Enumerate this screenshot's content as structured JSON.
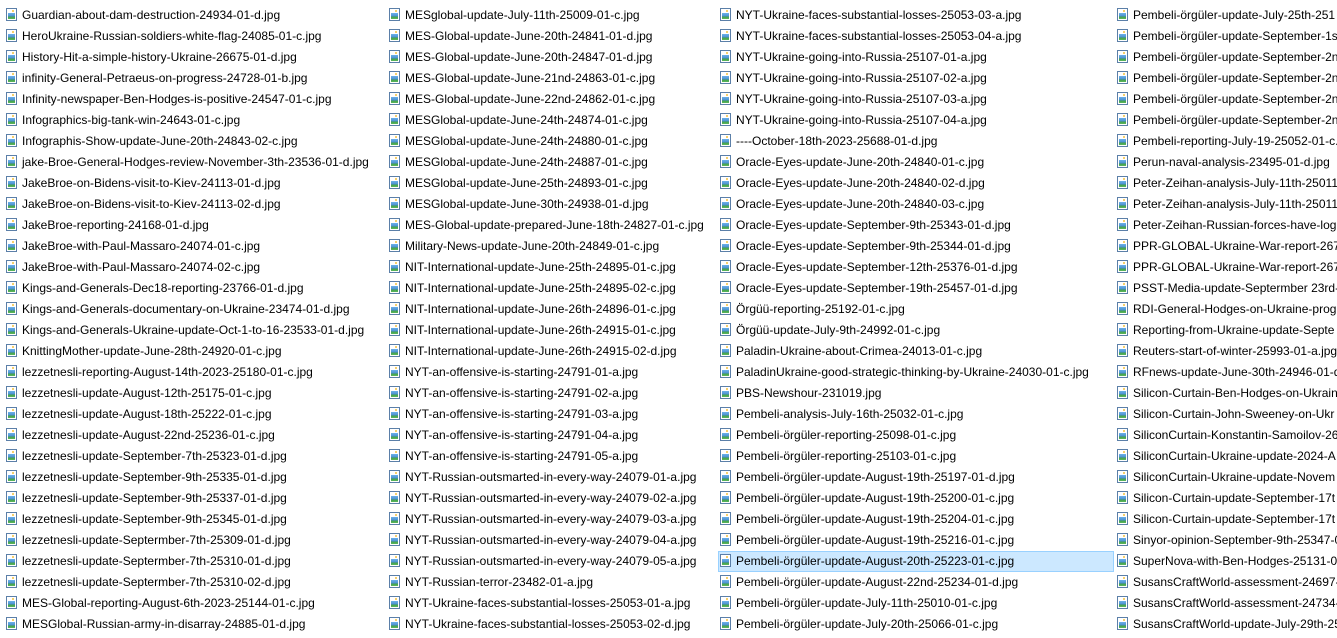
{
  "colors": {
    "selection_background": "#cce8ff",
    "selection_border": "#99d1ff",
    "text": "#000000"
  },
  "icon": "image-file-icon",
  "selected_file": "Pembeli-örgüler-update-August-20th-25223-01-c.jpg",
  "columns": [
    {
      "files": [
        "Guardian-about-dam-destruction-24934-01-d.jpg",
        "HeroUkraine-Russian-soldiers-white-flag-24085-01-c.jpg",
        "History-Hit-a-simple-history-Ukraine-26675-01-d.jpg",
        "infinity-General-Petraeus-on-progress-24728-01-b.jpg",
        "Infinity-newspaper-Ben-Hodges-is-positive-24547-01-c.jpg",
        "Infographics-big-tank-win-24643-01-c.jpg",
        "Infographis-Show-update-June-20th-24843-02-c.jpg",
        "jake-Broe-General-Hodges-review-November-3th-23536-01-d.jpg",
        "JakeBroe-on-Bidens-visit-to-Kiev-24113-01-d.jpg",
        "JakeBroe-on-Bidens-visit-to-Kiev-24113-02-d.jpg",
        "JakeBroe-reporting-24168-01-d.jpg",
        "JakeBroe-with-Paul-Massaro-24074-01-c.jpg",
        "JakeBroe-with-Paul-Massaro-24074-02-c.jpg",
        "Kings-and-Generals-Dec18-reporting-23766-01-d.jpg",
        "Kings-and-Generals-documentary-on-Ukraine-23474-01-d.jpg",
        "Kings-and-Generals-Ukraine-update-Oct-1-to-16-23533-01-d.jpg",
        "KnittingMother-update-June-28th-24920-01-c.jpg",
        "lezzetnesli-reporting-August-14th-2023-25180-01-c.jpg",
        "lezzetnesli-update-August-12th-25175-01-c.jpg",
        "lezzetnesli-update-August-18th-25222-01-c.jpg",
        "lezzetnesli-update-August-22nd-25236-01-c.jpg",
        "lezzetnesli-update-September-7th-25323-01-d.jpg",
        "lezzetnesli-update-September-9th-25335-01-d.jpg",
        "lezzetnesli-update-September-9th-25337-01-d.jpg",
        "lezzetnesli-update-September-9th-25345-01-d.jpg",
        "lezzetnesli-update-Septermber-7th-25309-01-d.jpg",
        "lezzetnesli-update-Septermber-7th-25310-01-d.jpg",
        "lezzetnesli-update-Septermber-7th-25310-02-d.jpg",
        "MES-Global-reporting-August-6th-2023-25144-01-c.jpg",
        "MESGlobal-Russian-army-in-disarray-24885-01-d.jpg"
      ]
    },
    {
      "files": [
        "MESglobal-update-July-11th-25009-01-c.jpg",
        "MES-Global-update-June-20th-24841-01-d.jpg",
        "MES-Global-update-June-20th-24847-01-d.jpg",
        "MES-Global-update-June-21nd-24863-01-c.jpg",
        "MES-Global-update-June-22nd-24862-01-c.jpg",
        "MESGlobal-update-June-24th-24874-01-c.jpg",
        "MESGlobal-update-June-24th-24880-01-c.jpg",
        "MESGlobal-update-June-24th-24887-01-c.jpg",
        "MESGlobal-update-June-25th-24893-01-c.jpg",
        "MESGlobal-update-June-30th-24938-01-d.jpg",
        "MES-Global-update-prepared-June-18th-24827-01-c.jpg",
        "Military-News-update-June-20th-24849-01-c.jpg",
        "NIT-International-update-June-25th-24895-01-c.jpg",
        "NIT-International-update-June-25th-24895-02-c.jpg",
        "NIT-International-update-June-26th-24896-01-c.jpg",
        "NIT-International-update-June-26th-24915-01-c.jpg",
        "NIT-International-update-June-26th-24915-02-d.jpg",
        "NYT-an-offensive-is-starting-24791-01-a.jpg",
        "NYT-an-offensive-is-starting-24791-02-a.jpg",
        "NYT-an-offensive-is-starting-24791-03-a.jpg",
        "NYT-an-offensive-is-starting-24791-04-a.jpg",
        "NYT-an-offensive-is-starting-24791-05-a.jpg",
        "NYT-Russian-outsmarted-in-every-way-24079-01-a.jpg",
        "NYT-Russian-outsmarted-in-every-way-24079-02-a.jpg",
        "NYT-Russian-outsmarted-in-every-way-24079-03-a.jpg",
        "NYT-Russian-outsmarted-in-every-way-24079-04-a.jpg",
        "NYT-Russian-outsmarted-in-every-way-24079-05-a.jpg",
        "NYT-Russian-terror-23482-01-a.jpg",
        "NYT-Ukraine-faces-substantial-losses-25053-01-a.jpg",
        "NYT-Ukraine-faces-substantial-losses-25053-02-d.jpg"
      ]
    },
    {
      "files": [
        "NYT-Ukraine-faces-substantial-losses-25053-03-a.jpg",
        "NYT-Ukraine-faces-substantial-losses-25053-04-a.jpg",
        "NYT-Ukraine-going-into-Russia-25107-01-a.jpg",
        "NYT-Ukraine-going-into-Russia-25107-02-a.jpg",
        "NYT-Ukraine-going-into-Russia-25107-03-a.jpg",
        "NYT-Ukraine-going-into-Russia-25107-04-a.jpg",
        "----October-18th-2023-25688-01-d.jpg",
        "Oracle-Eyes-update-June-20th-24840-01-c.jpg",
        "Oracle-Eyes-update-June-20th-24840-02-d.jpg",
        "Oracle-Eyes-update-June-20th-24840-03-c.jpg",
        "Oracle-Eyes-update-September-9th-25343-01-d.jpg",
        "Oracle-Eyes-update-September-9th-25344-01-d.jpg",
        "Oracle-Eyes-update-September-12th-25376-01-d.jpg",
        "Oracle-Eyes-update-September-19th-25457-01-d.jpg",
        "Örgüü-reporting-25192-01-c.jpg",
        "Örgüü-update-July-9th-24992-01-c.jpg",
        "Paladin-Ukraine-about-Crimea-24013-01-c.jpg",
        "PaladinUkraine-good-strategic-thinking-by-Ukraine-24030-01-c.jpg",
        "PBS-Newshour-231019.jpg",
        "Pembeli-analysis-July-16th-25032-01-c.jpg",
        "Pembeli-örgüler-reporting-25098-01-c.jpg",
        "Pembeli-örgüler-reporting-25103-01-c.jpg",
        "Pembeli-örgüler-update-August-19th-25197-01-d.jpg",
        "Pembeli-örgüler-update-August-19th-25200-01-c.jpg",
        "Pembeli-örgüler-update-August-19th-25204-01-c.jpg",
        "Pembeli-örgüler-update-August-19th-25216-01-c.jpg",
        "Pembeli-örgüler-update-August-20th-25223-01-c.jpg",
        "Pembeli-örgüler-update-August-22nd-25234-01-d.jpg",
        "Pembeli-örgüler-update-July-11th-25010-01-c.jpg",
        "Pembeli-örgüler-update-July-20th-25066-01-c.jpg"
      ]
    },
    {
      "files": [
        "Pembeli-örgüler-update-July-25th-251",
        "Pembeli-örgüler-update-September-1s",
        "Pembeli-örgüler-update-September-2n",
        "Pembeli-örgüler-update-September-2n",
        "Pembeli-örgüler-update-September-2n",
        "Pembeli-örgüler-update-September-2n",
        "Pembeli-reporting-July-19-25052-01-c.",
        "Perun-naval-analysis-23495-01-d.jpg",
        "Peter-Zeihan-analysis-July-11th-25011-",
        "Peter-Zeihan-analysis-July-11th-25011-",
        "Peter-Zeihan-Russian-forces-have-logi",
        "PPR-GLOBAL-Ukraine-War-report-2677",
        "PPR-GLOBAL-Ukraine-War-report-2677",
        "PSST-Media-update-Septermber 23rd-2",
        "RDI-General-Hodges-on-Ukraine-prog",
        "Reporting-from-Ukraine-update-Septe",
        "Reuters-start-of-winter-25993-01-a.jpg",
        "RFnews-update-June-30th-24946-01-d",
        "Silicon-Curtain-Ben-Hodges-on-Ukrain",
        "Silicon-Curtain-John-Sweeney-on-Ukr",
        "SiliconCurtain-Konstantin-Samoilov-26",
        "SiliconCurtain-Ukraine-update-2024-A",
        "SiliconCurtain-Ukraine-update-Novem",
        "Silicon-Curtain-update-September-17t",
        "Silicon-Curtain-update-September-17t",
        "Sinyor-opinion-September-9th-25347-0",
        "SuperNova-with-Ben-Hodges-25131-0",
        "SusansCraftWorld-assessment-24697-0",
        "SusansCraftWorld-assessment-24734-0",
        "SusansCraftWorld-update-July-29th-25"
      ]
    }
  ]
}
